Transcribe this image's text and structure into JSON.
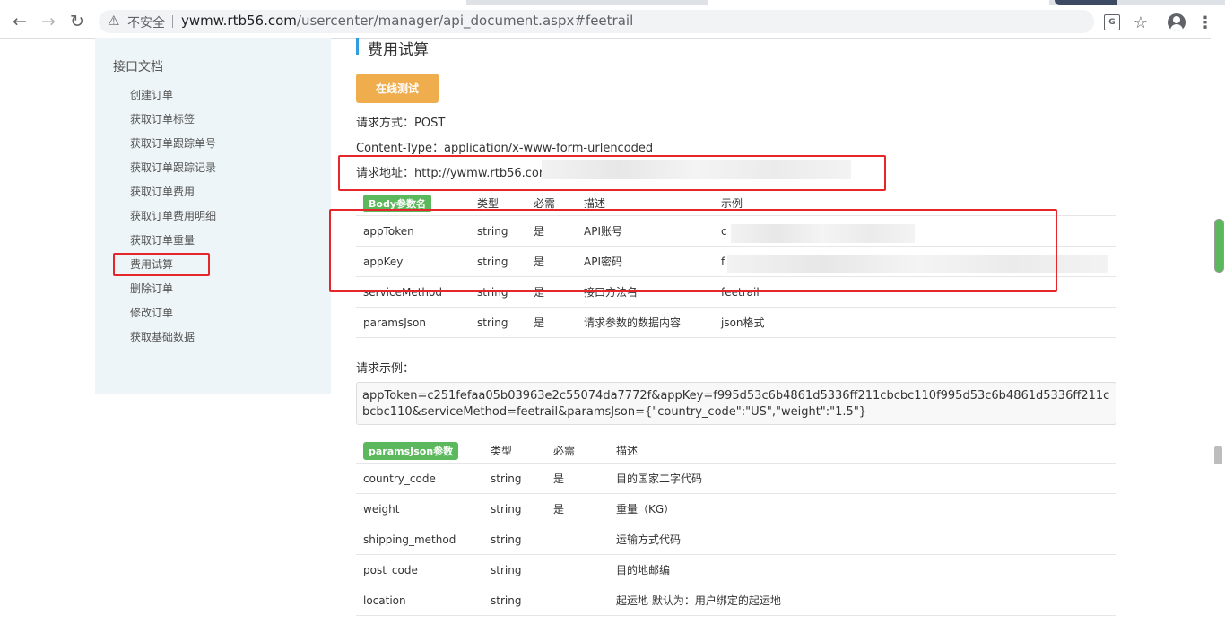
{
  "browser": {
    "url_host": "ywmw.rtb56.com",
    "url_path": "/usercenter/manager/api_document.aspx#feetrail",
    "insecure_label": "不安全",
    "icons": [
      "back-arrow-icon",
      "forward-arrow-icon",
      "reload-icon",
      "warning-icon",
      "translate-icon",
      "star-icon",
      "account-icon",
      "menu-dots-icon"
    ]
  },
  "sidebar": {
    "title": "接口文档",
    "items": [
      {
        "label": "创建订单"
      },
      {
        "label": "获取订单标签"
      },
      {
        "label": "获取订单跟踪单号"
      },
      {
        "label": "获取订单跟踪记录"
      },
      {
        "label": "获取订单费用"
      },
      {
        "label": "获取订单费用明细"
      },
      {
        "label": "获取订单重量"
      },
      {
        "label": "费用试算"
      },
      {
        "label": "删除订单"
      },
      {
        "label": "修改订单"
      },
      {
        "label": "获取基础数据"
      }
    ]
  },
  "main": {
    "section_title": "费用试算",
    "test_button": "在线测试",
    "request_method": "请求方式：POST",
    "content_type": "Content-Type：application/x-www-form-urlencoded",
    "request_url": "请求地址：http://ywmw.rtb56.cor",
    "body_table": {
      "headers": [
        "Body参数名",
        "类型",
        "必需",
        "描述",
        "示例"
      ],
      "rows": [
        {
          "name": "appToken",
          "type": "string",
          "required": "是",
          "desc": "API账号",
          "example": "c"
        },
        {
          "name": "appKey",
          "type": "string",
          "required": "是",
          "desc": "API密码",
          "example": "f"
        },
        {
          "name": "serviceMethod",
          "type": "string",
          "required": "是",
          "desc": "接口方法名",
          "example": "feetrail"
        },
        {
          "name": "paramsJson",
          "type": "string",
          "required": "是",
          "desc": "请求参数的数据内容",
          "example": "json格式"
        }
      ]
    },
    "example_label": "请求示例：",
    "example_text": "appToken=c251fefaa05b03963e2c55074da7772f&appKey=f995d53c6b4861d5336ff211cbcbc110f995d53c6b4861d5336ff211cbcbc110&serviceMethod=feetrail&paramsJson={\"country_code\":\"US\",\"weight\":\"1.5\"}",
    "params_table": {
      "headers": [
        "paramsJson参数",
        "类型",
        "必需",
        "描述"
      ],
      "rows": [
        {
          "name": "country_code",
          "type": "string",
          "required": "是",
          "desc": "目的国家二字代码"
        },
        {
          "name": "weight",
          "type": "string",
          "required": "是",
          "desc": "重量（KG）"
        },
        {
          "name": "shipping_method",
          "type": "string",
          "required": "",
          "desc": "运输方式代码"
        },
        {
          "name": "post_code",
          "type": "string",
          "required": "",
          "desc": "目的地邮编"
        },
        {
          "name": "location",
          "type": "string",
          "required": "",
          "desc": "起运地 默认为：用户绑定的起运地"
        }
      ]
    }
  },
  "colors": {
    "accent_blue": "#2e9ee0",
    "button_orange": "#f0ad4e",
    "badge_green": "#5cb85c",
    "highlight_red": "#e5262a",
    "sidebar_bg": "#eef5f8"
  }
}
